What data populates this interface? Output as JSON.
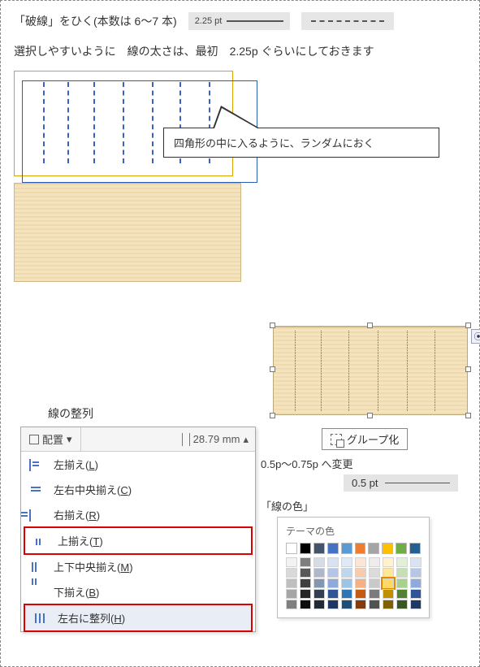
{
  "line1_text": "「破線」をひく(本数は 6～7 本)",
  "sample_weight_label": "2.25 pt",
  "line2_text": "選択しやすいように　線の太さは、最初　2.25p ぐらいにしておきます",
  "callout_text": "四角形の中に入るように、ランダムにおく",
  "group_button_label": "グループ化",
  "align_section_title": "線の整列",
  "align_menu": {
    "dropdown_label": "配置",
    "dimension_value": "28.79 mm",
    "items": [
      {
        "label": "左揃え",
        "key": "L"
      },
      {
        "label": "左右中央揃え",
        "key": "C"
      },
      {
        "label": "右揃え",
        "key": "R"
      },
      {
        "label": "上揃え",
        "key": "T"
      },
      {
        "label": "上下中央揃え",
        "key": "M"
      },
      {
        "label": "下揃え",
        "key": "B"
      },
      {
        "label": "左右に整列",
        "key": "H"
      }
    ]
  },
  "change_weight_text": "0.5p～0.75p へ変更",
  "weight05_label": "0.5 pt",
  "line_color_title": "「線の色」",
  "palette_title": "テーマの色",
  "palette_row": [
    "#ffffff",
    "#000000",
    "#44546a",
    "#4472c4",
    "#5b9bd5",
    "#ed7d31",
    "#a5a5a5",
    "#ffc000",
    "#70ad47",
    "#255e91"
  ],
  "palette_tints": [
    [
      "#f2f2f2",
      "#d9d9d9",
      "#bfbfbf",
      "#a6a6a6",
      "#808080"
    ],
    [
      "#7f7f7f",
      "#595959",
      "#404040",
      "#262626",
      "#0d0d0d"
    ],
    [
      "#d6dce5",
      "#adb9ca",
      "#8497b0",
      "#333f50",
      "#222a35"
    ],
    [
      "#d9e1f2",
      "#b4c6e7",
      "#8ea9db",
      "#2f5597",
      "#1f3864"
    ],
    [
      "#deebf7",
      "#bdd7ee",
      "#9dc3e6",
      "#2e75b6",
      "#1f4e79"
    ],
    [
      "#fbe5d6",
      "#f8cbad",
      "#f4b183",
      "#c55a11",
      "#843c0c"
    ],
    [
      "#ededed",
      "#dbdbdb",
      "#c9c9c9",
      "#7b7b7b",
      "#525252"
    ],
    [
      "#fff2cc",
      "#ffe699",
      "#ffd966",
      "#bf9000",
      "#806000"
    ],
    [
      "#e2f0d9",
      "#c5e0b4",
      "#a9d18e",
      "#548235",
      "#385723"
    ],
    [
      "#dae3f3",
      "#b4c7e7",
      "#8faadc",
      "#2f5597",
      "#203864"
    ]
  ],
  "selected_swatch": {
    "col": 7,
    "row": 2
  }
}
